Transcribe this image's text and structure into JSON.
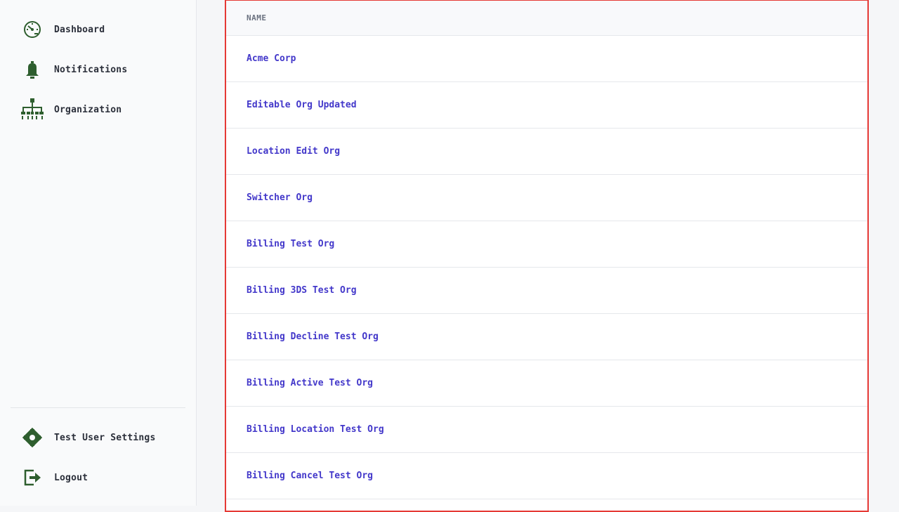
{
  "sidebar": {
    "nav": [
      {
        "label": "Dashboard",
        "icon": "dashboard-gauge-icon"
      },
      {
        "label": "Notifications",
        "icon": "bell-icon"
      },
      {
        "label": "Organization",
        "icon": "org-chart-icon"
      }
    ],
    "bottom": [
      {
        "label": "Test User Settings",
        "icon": "gear-icon"
      },
      {
        "label": "Logout",
        "icon": "logout-icon"
      }
    ]
  },
  "table": {
    "header": "NAME",
    "rows": [
      "Acme Corp",
      "Editable Org Updated",
      "Location Edit Org",
      "Switcher Org",
      "Billing Test Org",
      "Billing 3DS Test Org",
      "Billing Decline Test Org",
      "Billing Active Test Org",
      "Billing Location Test Org",
      "Billing Cancel Test Org"
    ]
  },
  "colors": {
    "icon_green": "#2e5e2e",
    "link_blue": "#4338ca",
    "highlight_border": "#e53935"
  }
}
